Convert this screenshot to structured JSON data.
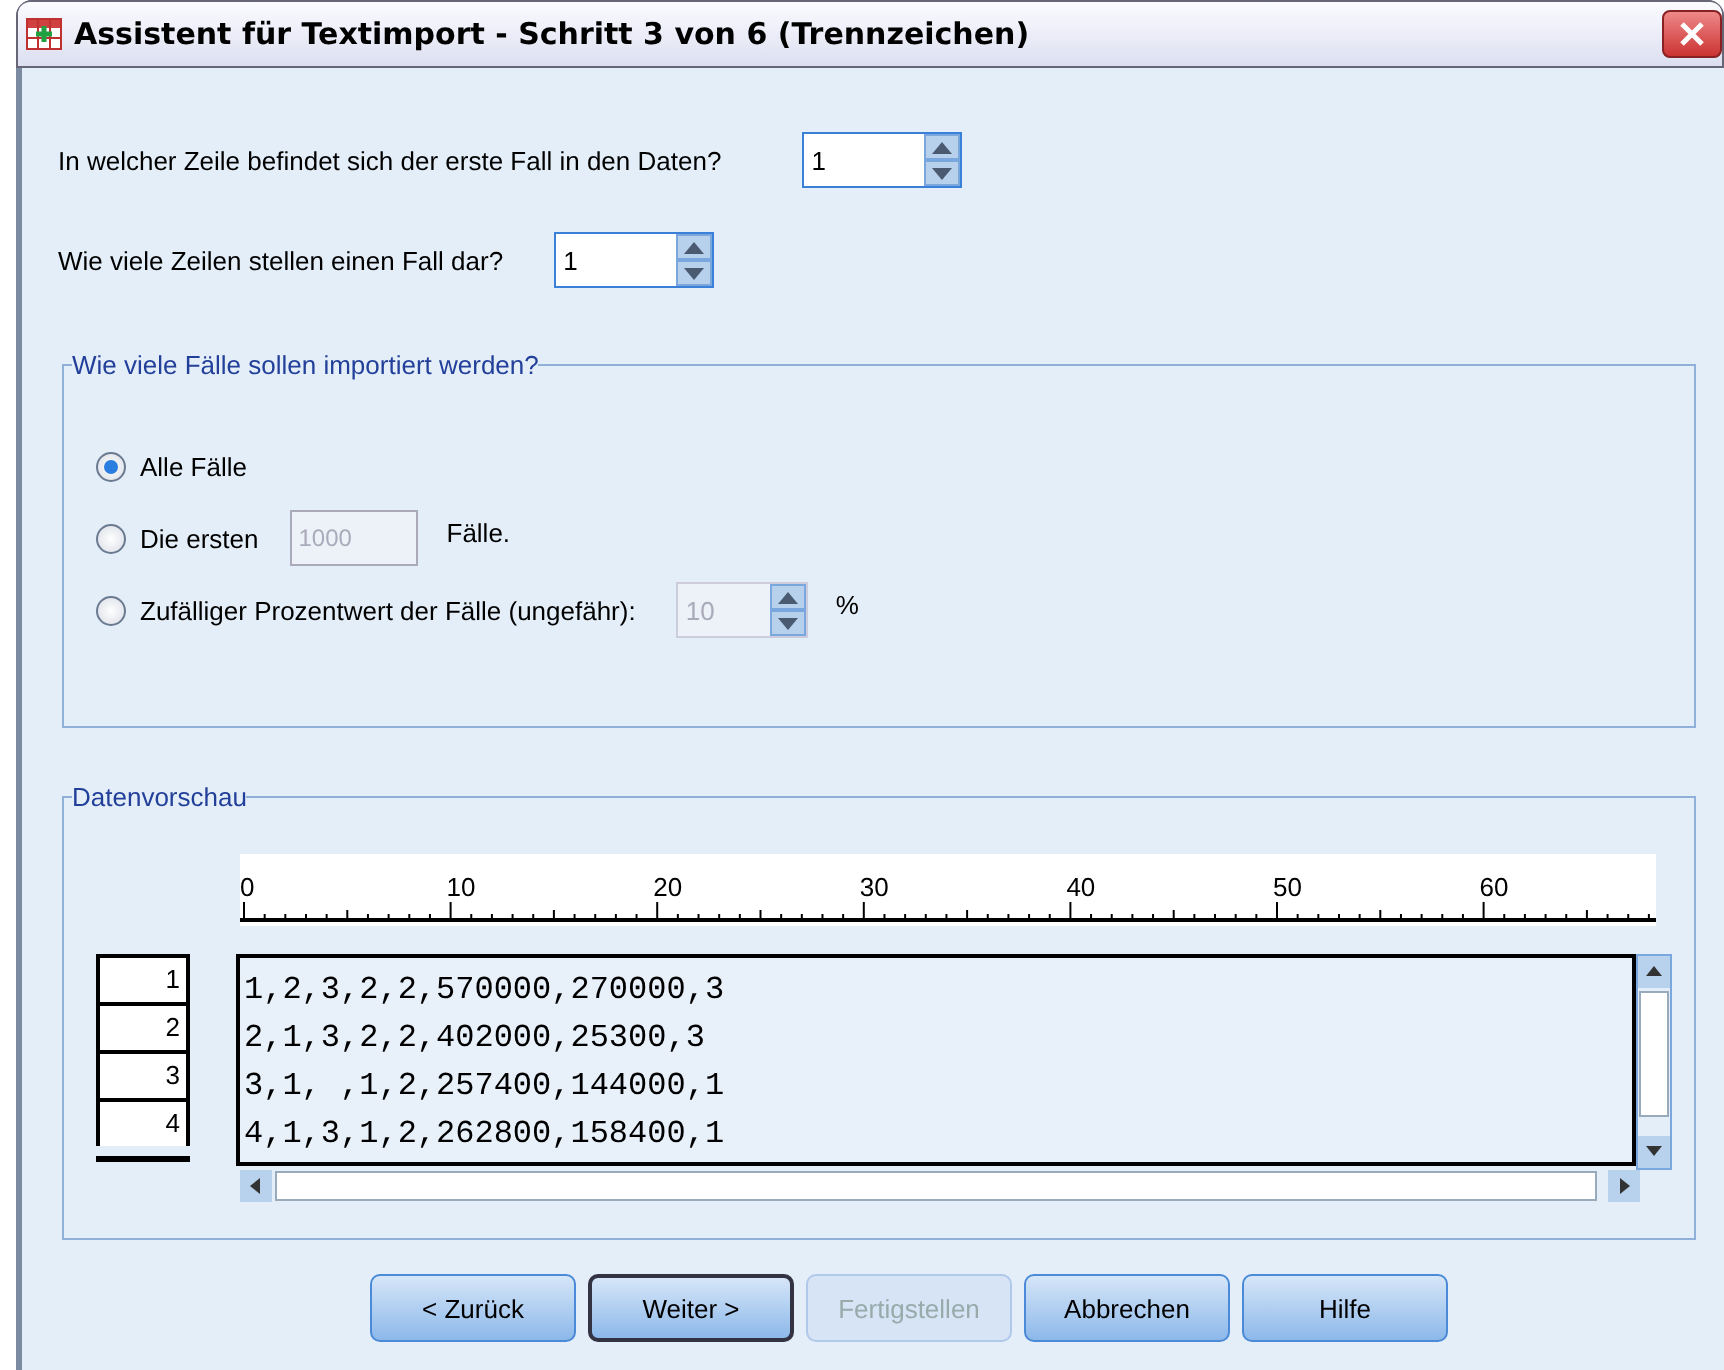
{
  "window": {
    "title": "Assistent für Textimport - Schritt 3 von 6 (Trennzeichen)"
  },
  "questions": [
    {
      "label": "In welcher Zeile befindet sich der erste Fall in den Daten?",
      "value": "1"
    },
    {
      "label": "Wie viele Zeilen stellen einen Fall dar?",
      "value": "1"
    }
  ],
  "cases_group": {
    "title": "Wie viele Fälle sollen importiert werden?",
    "options": [
      {
        "kind": "plain",
        "label": "Alle Fälle",
        "selected": true
      },
      {
        "kind": "count",
        "label": "Die ersten",
        "value": "1000",
        "suffix": "Fälle.",
        "selected": false,
        "disabled": true
      },
      {
        "kind": "percent",
        "label": "Zufälliger Prozentwert der Fälle (ungefähr):",
        "value": "10",
        "suffix": "%",
        "selected": false,
        "disabled": true
      }
    ]
  },
  "preview": {
    "title": "Datenvorschau",
    "ruler": [
      "0",
      "10",
      "20",
      "30",
      "40",
      "50",
      "60"
    ],
    "rows": [
      {
        "number": "1",
        "text": "1,2,3,2,2,570000,270000,3"
      },
      {
        "number": "2",
        "text": "2,1,3,2,2,402000,25300,3"
      },
      {
        "number": "3",
        "text": "3,1, ,1,2,257400,144000,1"
      },
      {
        "number": "4",
        "text": "4,1,3,1,2,262800,158400,1"
      }
    ]
  },
  "buttons": [
    {
      "label": "< Zurück",
      "default": false,
      "disabled": false
    },
    {
      "label": "Weiter >",
      "default": true,
      "disabled": false
    },
    {
      "label": "Fertigstellen",
      "default": false,
      "disabled": true
    },
    {
      "label": "Abbrechen",
      "default": false,
      "disabled": false
    },
    {
      "label": "Hilfe",
      "default": false,
      "disabled": false
    }
  ]
}
